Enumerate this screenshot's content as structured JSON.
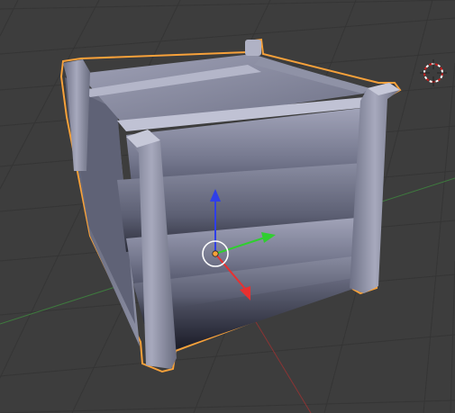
{
  "viewport": {
    "background": "#3d3d3d",
    "grid_color": "#353535",
    "selection_outline_color": "#f7a13a"
  },
  "scene": {
    "object": {
      "icon": "wooden-crate-mesh",
      "selected": true
    },
    "axes": {
      "x_color": "#e83030",
      "y_color": "#2fcf2f",
      "z_color": "#2f3fe8"
    },
    "cursor_3d": {
      "icon": "crosshair-3d-cursor-icon",
      "color": "#c41e1e"
    },
    "manipulator": {
      "icon": "translate-gizmo-icon",
      "origin_color": "#f7a13a"
    }
  }
}
